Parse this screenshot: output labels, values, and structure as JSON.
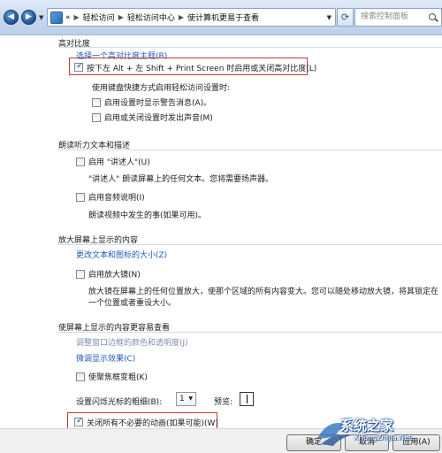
{
  "nav": {
    "back_icon": "back-arrow-icon",
    "forward_icon": "forward-arrow-icon",
    "breadcrumb_prefix": "«",
    "breadcrumb": [
      "轻松访问",
      "轻松访问中心",
      "使计算机更易于查看"
    ],
    "search_placeholder": "搜索控制面板"
  },
  "high_contrast": {
    "title": "高对比度",
    "choose_theme_link": "选择一个高对比度主题(R)",
    "toggle_label": "按下左 Alt + 左 Shift + Print Screen 时启用或关闭高对比度(L)",
    "toggle_checked": true,
    "shortcut_heading": "使用键盘快捷方式启用轻松访问设置时:",
    "warning_label": "启用设置时显示警告消息(A)。",
    "sound_label": "启用或关闭设置时发出声音(M)"
  },
  "narrator": {
    "title": "朗读听力文本和描述",
    "enable_label": "启用 \"讲述人\"(U)",
    "enable_desc": "\"讲述人\" 朗读屏幕上的任何文本。您将需要扬声器。",
    "audio_label": "启用音频说明(I)",
    "audio_desc": "朗读视频中发生的事(如果可用)。"
  },
  "magnify": {
    "title": "放大屏幕上显示的内容",
    "change_size_link": "更改文本和图标的大小(Z)",
    "enable_label": "启用放大镜(N)",
    "desc_line1": "放大镜在屏幕上的任何位置放大，使那个区域的所有内容变大。您可以随处移动放大镜，将其锁定在",
    "desc_line2": "一个位置或者重设大小。"
  },
  "easier": {
    "title": "使屏幕上显示的内容更容易查看",
    "window_color_link": "调整窗口边框的颜色和透明度(J)",
    "fine_tune_link": "微调显示效果(C)",
    "focus_label": "使聚焦框变粗(K)",
    "cursor_width_label": "设置闪烁光标的粗细(B):",
    "cursor_width_value": "1",
    "preview_label": "预览:",
    "animations_label": "关闭所有不必要的动画(如果可能)(W)",
    "animations_checked": true
  },
  "buttons": {
    "ok": "确定",
    "cancel": "取消",
    "apply": "应用(A)"
  },
  "watermark": {
    "text": "系统之家",
    "url": "XiTongZhiJia.Net"
  },
  "colors": {
    "link": "#1f5cb8",
    "highlight_box": "#c0393b"
  }
}
